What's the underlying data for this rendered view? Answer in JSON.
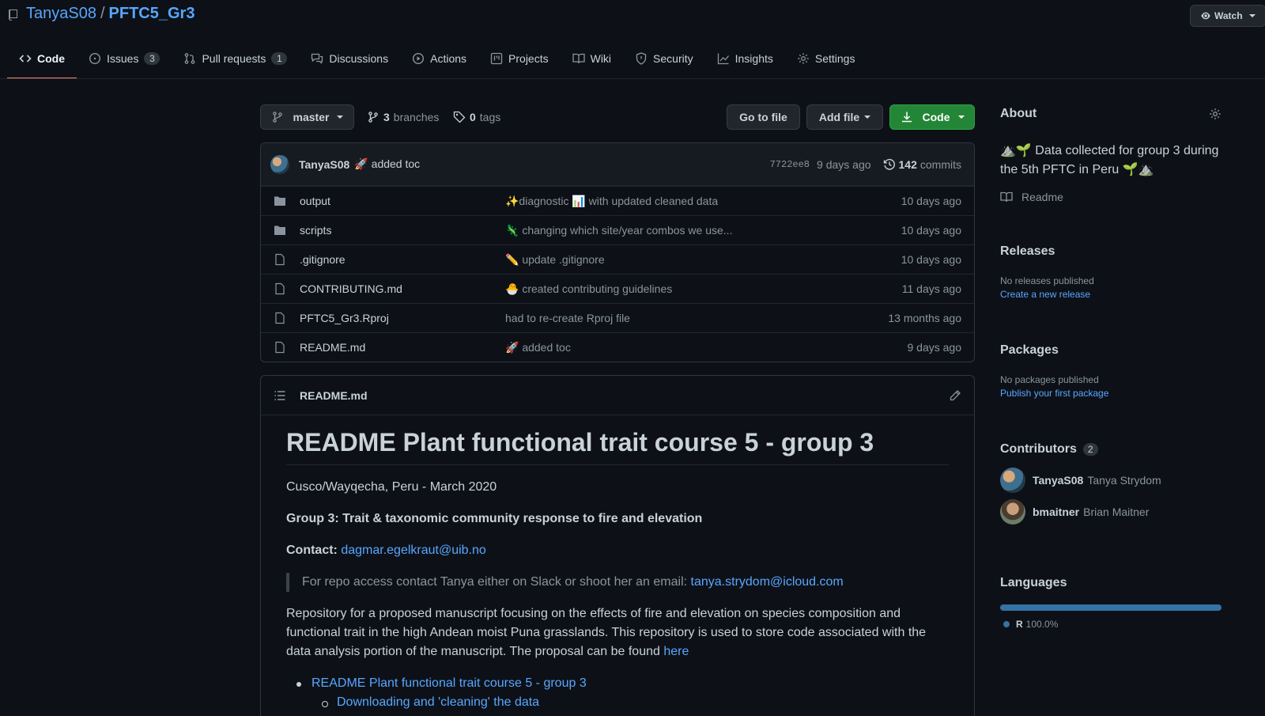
{
  "repo": {
    "owner": "TanyaS08",
    "separator": "/",
    "name": "PFTC5_Gr3",
    "watch_label": "Watch"
  },
  "tabs": [
    {
      "label": "Code",
      "count": "",
      "icon": "code-icon"
    },
    {
      "label": "Issues",
      "count": "3",
      "icon": "issue-icon"
    },
    {
      "label": "Pull requests",
      "count": "1",
      "icon": "pull-request-icon"
    },
    {
      "label": "Discussions",
      "count": "",
      "icon": "discussion-icon"
    },
    {
      "label": "Actions",
      "count": "",
      "icon": "play-icon"
    },
    {
      "label": "Projects",
      "count": "",
      "icon": "project-icon"
    },
    {
      "label": "Wiki",
      "count": "",
      "icon": "book-icon"
    },
    {
      "label": "Security",
      "count": "",
      "icon": "shield-icon"
    },
    {
      "label": "Insights",
      "count": "",
      "icon": "graph-icon"
    },
    {
      "label": "Settings",
      "count": "",
      "icon": "gear-icon"
    }
  ],
  "branch": {
    "current": "master",
    "branches_count": "3",
    "branches_label": "branches",
    "tags_count": "0",
    "tags_label": "tags",
    "go_to_file": "Go to file",
    "add_file": "Add file",
    "code": "Code"
  },
  "commit": {
    "author": "TanyaS08",
    "message": "🚀 added toc",
    "sha": "7722ee8",
    "age": "9 days ago",
    "count": "142",
    "count_label": "commits"
  },
  "files": [
    {
      "type": "folder",
      "name": "output",
      "message": "✨diagnostic 📊 with updated cleaned data",
      "age": "10 days ago"
    },
    {
      "type": "folder",
      "name": "scripts",
      "message": "🦎 changing which site/year combos we use...",
      "age": "10 days ago"
    },
    {
      "type": "file",
      "name": ".gitignore",
      "message": "✏️ update .gitignore",
      "age": "10 days ago"
    },
    {
      "type": "file",
      "name": "CONTRIBUTING.md",
      "message": "🐣 created contributing guidelines",
      "age": "11 days ago"
    },
    {
      "type": "file",
      "name": "PFTC5_Gr3.Rproj",
      "message": "had to re-create Rproj file",
      "age": "13 months ago"
    },
    {
      "type": "file",
      "name": "README.md",
      "message": "🚀 added toc",
      "age": "9 days ago"
    }
  ],
  "readme": {
    "filename": "README.md",
    "heading": "README Plant functional trait course 5 - group 3",
    "location": "Cusco/Wayqecha, Peru - March 2020",
    "group": "Group 3: Trait & taxonomic community response to fire and elevation",
    "contact_label": "Contact:",
    "contact_email": "dagmar.egelkraut@uib.no",
    "quote_text": "For repo access contact Tanya either on Slack or shoot her an email:",
    "quote_email": "tanya.strydom@icloud.com",
    "description": "Repository for a proposed manuscript focusing on the effects of fire and elevation on species composition and functional trait in the high Andean moist Puna grasslands. This repository is used to store code associated with the data analysis portion of the manuscript. The proposal can be found",
    "description_link": "here",
    "toc": [
      "README Plant functional trait course 5 - group 3",
      "Downloading and 'cleaning' the data"
    ]
  },
  "about": {
    "title": "About",
    "description": "⛰️🌱 Data collected for group 3 during the 5th PFTC in Peru 🌱⛰️",
    "readme_label": "Readme"
  },
  "releases": {
    "title": "Releases",
    "empty": "No releases published",
    "link": "Create a new release"
  },
  "packages": {
    "title": "Packages",
    "empty": "No packages published",
    "link": "Publish your first package"
  },
  "contributors": {
    "title": "Contributors",
    "count": "2",
    "people": [
      {
        "login": "TanyaS08",
        "name": "Tanya Strydom"
      },
      {
        "login": "bmaitner",
        "name": "Brian Maitner"
      }
    ]
  },
  "languages": {
    "title": "Languages",
    "items": [
      {
        "name": "R",
        "percent": "100.0%",
        "color": "#3572a5"
      }
    ]
  },
  "colors": {
    "accent": "#58a6ff",
    "green": "#238636",
    "tab_underline": "#f78166",
    "background": "#0d1117"
  }
}
